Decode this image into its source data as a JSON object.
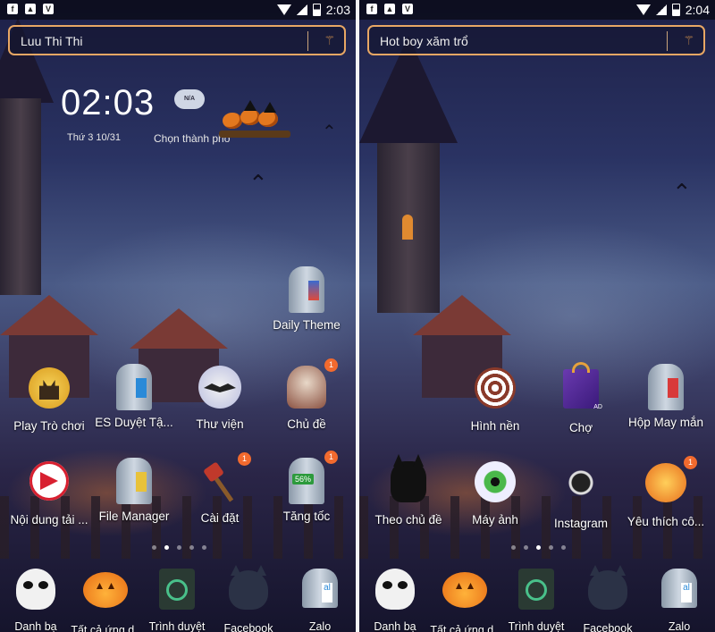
{
  "left_screen": {
    "status": {
      "time": "2:03"
    },
    "search": {
      "query": "Luu Thi Thi"
    },
    "widget": {
      "time": "02:03",
      "date": "Thứ 3 10/31",
      "weather": "N/A",
      "city": "Chọn thành phố"
    },
    "apps": [
      {
        "label": "Daily Theme",
        "icon": "tombstone-theme-icon"
      },
      {
        "label": "Play Trò chơi",
        "icon": "haunted-house-icon"
      },
      {
        "label": "ES Duyệt Tậ...",
        "icon": "tombstone-es-icon"
      },
      {
        "label": "Thư viện",
        "icon": "moon-bat-icon"
      },
      {
        "label": "Chủ đề",
        "icon": "skull-icon",
        "badge": "1"
      },
      {
        "label": "Nội dung tải ...",
        "icon": "download-content-icon"
      },
      {
        "label": "File Manager",
        "icon": "tombstone-folder-icon"
      },
      {
        "label": "Cài đặt",
        "icon": "axe-icon",
        "badge": "1"
      },
      {
        "label": "Tăng tốc",
        "icon": "booster-icon",
        "badge": "1",
        "percent": "56%"
      }
    ],
    "dock": [
      {
        "label": "Danh bạ",
        "icon": "jack-skull-icon"
      },
      {
        "label": "Tất cả ứng d...",
        "icon": "pumpkin-icon"
      },
      {
        "label": "Trình duyệt",
        "icon": "speaker-browser-icon"
      },
      {
        "label": "Facebook",
        "icon": "cat-icon"
      },
      {
        "label": "Zalo",
        "icon": "tombstone-zalo-icon"
      }
    ],
    "page_dots": {
      "count": 5,
      "active": 1
    }
  },
  "right_screen": {
    "status": {
      "time": "2:04"
    },
    "search": {
      "query": "Hot boy xăm trổ"
    },
    "apps": [
      {
        "label": "Hình nền",
        "icon": "spiral-icon"
      },
      {
        "label": "Chợ",
        "icon": "shopping-bag-icon",
        "tag": "AD"
      },
      {
        "label": "Hộp May mắn",
        "icon": "tombstone-lucky-icon"
      },
      {
        "label": "Theo chủ đề",
        "icon": "black-cat-icon"
      },
      {
        "label": "Máy ảnh",
        "icon": "eyeball-icon"
      },
      {
        "label": "Instagram",
        "icon": "spider-icon"
      },
      {
        "label": "Yêu thích cô...",
        "icon": "gift-pumpkin-icon",
        "badge": "1"
      }
    ],
    "dock": [
      {
        "label": "Danh bạ",
        "icon": "jack-skull-icon"
      },
      {
        "label": "Tất cả ứng d...",
        "icon": "pumpkin-icon"
      },
      {
        "label": "Trình duyệt",
        "icon": "speaker-browser-icon"
      },
      {
        "label": "Facebook",
        "icon": "cat-icon"
      },
      {
        "label": "Zalo",
        "icon": "tombstone-zalo-icon"
      }
    ],
    "page_dots": {
      "count": 5,
      "active": 2
    }
  },
  "colors": {
    "search_border": "#e8a764",
    "badge": "#f26a2e"
  }
}
